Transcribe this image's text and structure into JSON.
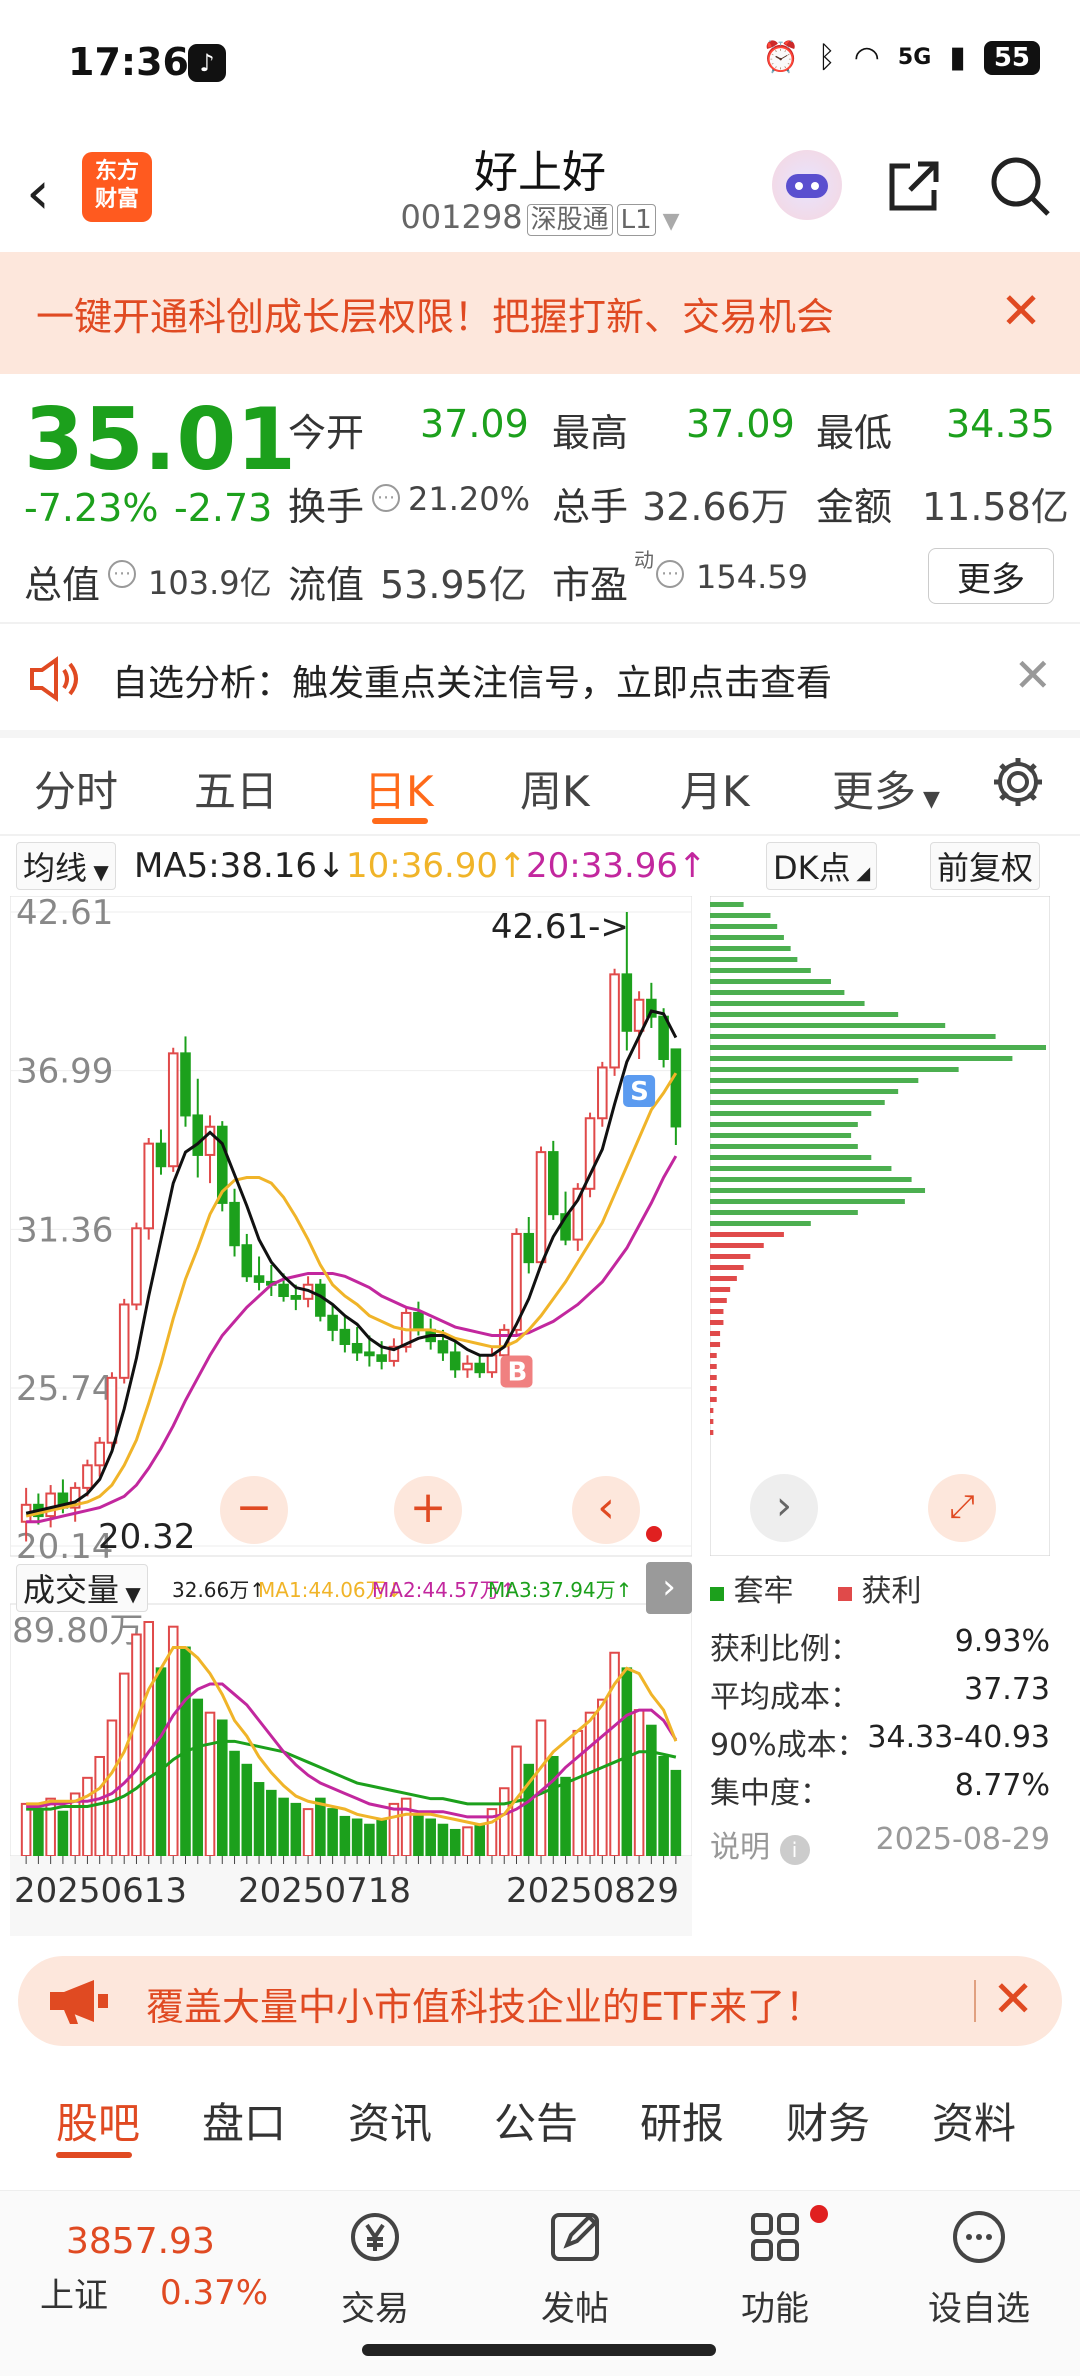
{
  "status_bar": {
    "time": "17:36",
    "signal": "5G",
    "battery": "55"
  },
  "header": {
    "logo_line1": "东方",
    "logo_line2": "财富",
    "title": "好上好",
    "code": "001298",
    "tag1": "深股通",
    "tag2": "L1"
  },
  "banner": {
    "text": "一键开通科创成长层权限！把握打新、交易机会"
  },
  "quote": {
    "price": "35.01",
    "change_pct": "-7.23%",
    "change": "-2.73",
    "open_label": "今开",
    "open": "37.09",
    "high_label": "最高",
    "high": "37.09",
    "low_label": "最低",
    "low": "34.35",
    "turnover_label": "换手",
    "turnover": "21.20%",
    "volume_label": "总手",
    "volume": "32.66万",
    "amount_label": "金额",
    "amount": "11.58亿",
    "mktcap_label": "总值",
    "mktcap": "103.9亿",
    "float_label": "流值",
    "float": "53.95亿",
    "pe_label": "市盈",
    "pe_sup": "动",
    "pe": "154.59",
    "more": "更多"
  },
  "notice": {
    "text": "自选分析：触发重点关注信号，立即点击查看"
  },
  "tabs": {
    "items": [
      "分时",
      "五日",
      "日K",
      "周K",
      "月K",
      "更多"
    ],
    "active": "日K"
  },
  "ma": {
    "selector": "均线",
    "ma5": "MA5:38.16",
    "ma10": "10:36.90",
    "ma20": "20:33.96",
    "dk": "DK点",
    "adj": "前复权"
  },
  "chart_data": {
    "type": "candlestick",
    "y_ticks": [
      "42.61",
      "36.99",
      "31.36",
      "25.74",
      "20.14"
    ],
    "ylim": [
      20.14,
      42.61
    ],
    "max_label": "42.61->",
    "min_label": "20.32",
    "candles": [
      [
        21.0,
        22.2,
        20.3,
        21.6
      ],
      [
        21.6,
        22.0,
        20.9,
        21.2
      ],
      [
        21.2,
        22.3,
        20.8,
        22.0
      ],
      [
        22.0,
        22.5,
        21.3,
        21.5
      ],
      [
        21.5,
        22.4,
        21.0,
        22.2
      ],
      [
        22.2,
        23.2,
        21.9,
        23.0
      ],
      [
        23.0,
        24.0,
        22.6,
        23.8
      ],
      [
        23.8,
        26.3,
        23.6,
        26.1
      ],
      [
        26.1,
        28.9,
        25.9,
        28.7
      ],
      [
        28.7,
        31.6,
        28.5,
        31.4
      ],
      [
        31.4,
        34.6,
        31.0,
        34.4
      ],
      [
        34.4,
        34.9,
        33.3,
        33.6
      ],
      [
        33.6,
        37.8,
        33.4,
        37.6
      ],
      [
        37.6,
        38.2,
        35.0,
        35.4
      ],
      [
        35.4,
        36.7,
        33.2,
        34.0
      ],
      [
        34.0,
        35.4,
        33.0,
        35.0
      ],
      [
        35.0,
        35.2,
        32.0,
        32.3
      ],
      [
        32.3,
        32.8,
        30.4,
        30.8
      ],
      [
        30.8,
        31.2,
        29.5,
        29.7
      ],
      [
        29.7,
        30.4,
        29.2,
        29.5
      ],
      [
        29.5,
        30.1,
        29.0,
        29.4
      ],
      [
        29.4,
        29.8,
        28.8,
        29.0
      ],
      [
        29.0,
        29.4,
        28.5,
        28.9
      ],
      [
        28.9,
        29.7,
        28.6,
        29.4
      ],
      [
        29.4,
        29.6,
        28.1,
        28.3
      ],
      [
        28.3,
        28.7,
        27.4,
        27.8
      ],
      [
        27.8,
        28.3,
        27.0,
        27.3
      ],
      [
        27.3,
        27.9,
        26.7,
        27.0
      ],
      [
        27.0,
        27.6,
        26.5,
        26.9
      ],
      [
        26.9,
        27.4,
        26.4,
        26.7
      ],
      [
        26.7,
        27.5,
        26.5,
        27.2
      ],
      [
        27.2,
        28.6,
        27.0,
        28.4
      ],
      [
        28.4,
        28.8,
        27.6,
        27.8
      ],
      [
        27.8,
        28.2,
        27.1,
        27.4
      ],
      [
        27.4,
        27.8,
        26.7,
        27.0
      ],
      [
        27.0,
        27.4,
        26.1,
        26.4
      ],
      [
        26.4,
        26.9,
        26.1,
        26.6
      ],
      [
        26.6,
        26.9,
        26.1,
        26.3
      ],
      [
        26.3,
        27.2,
        26.1,
        26.9
      ],
      [
        26.9,
        28.0,
        26.6,
        27.8
      ],
      [
        27.8,
        31.4,
        27.6,
        31.2
      ],
      [
        31.2,
        31.8,
        29.8,
        30.2
      ],
      [
        30.2,
        34.3,
        30.0,
        34.1
      ],
      [
        34.1,
        34.5,
        31.7,
        31.9
      ],
      [
        31.9,
        32.7,
        30.8,
        31.0
      ],
      [
        31.0,
        33.0,
        30.6,
        32.8
      ],
      [
        32.8,
        35.5,
        32.5,
        35.3
      ],
      [
        35.3,
        37.3,
        35.0,
        37.1
      ],
      [
        37.1,
        40.6,
        36.8,
        40.4
      ],
      [
        40.4,
        42.61,
        37.7,
        38.4
      ],
      [
        38.4,
        39.8,
        37.4,
        39.5
      ],
      [
        39.5,
        40.1,
        38.5,
        38.9
      ],
      [
        38.9,
        39.2,
        37.1,
        37.4
      ],
      [
        37.74,
        37.09,
        34.35,
        35.01
      ]
    ],
    "ma5": [
      21.3,
      21.4,
      21.5,
      21.6,
      21.7,
      22.0,
      22.5,
      23.5,
      25.0,
      26.8,
      29.0,
      31.0,
      33.0,
      34.1,
      34.4,
      34.8,
      34.4,
      33.3,
      32.2,
      31.0,
      30.2,
      29.7,
      29.3,
      29.2,
      29.0,
      28.7,
      28.3,
      28.0,
      27.5,
      27.2,
      27.1,
      27.3,
      27.5,
      27.6,
      27.6,
      27.4,
      27.1,
      26.9,
      26.9,
      27.2,
      28.0,
      28.9,
      30.1,
      31.1,
      31.8,
      32.4,
      33.3,
      34.2,
      35.8,
      37.3,
      38.2,
      39.1,
      39.0,
      38.16
    ],
    "ma10": [
      21.2,
      21.3,
      21.4,
      21.5,
      21.6,
      21.7,
      21.9,
      22.3,
      23.0,
      23.9,
      25.2,
      26.6,
      28.2,
      29.6,
      30.7,
      31.9,
      32.7,
      33.1,
      33.2,
      33.2,
      33.0,
      32.5,
      31.8,
      31.0,
      30.1,
      29.4,
      29.0,
      28.7,
      28.3,
      28.1,
      27.9,
      27.8,
      27.8,
      27.8,
      27.7,
      27.5,
      27.4,
      27.3,
      27.2,
      27.2,
      27.4,
      27.8,
      28.3,
      28.9,
      29.5,
      30.2,
      30.9,
      31.6,
      32.6,
      33.6,
      34.6,
      35.6,
      36.2,
      36.9
    ],
    "ma20": [
      21.0,
      21.0,
      21.1,
      21.2,
      21.3,
      21.4,
      21.5,
      21.7,
      21.9,
      22.3,
      22.9,
      23.6,
      24.4,
      25.3,
      26.1,
      26.9,
      27.6,
      28.1,
      28.6,
      29.0,
      29.4,
      29.6,
      29.7,
      29.8,
      29.8,
      29.8,
      29.7,
      29.5,
      29.3,
      29.0,
      28.8,
      28.6,
      28.5,
      28.3,
      28.1,
      27.9,
      27.8,
      27.7,
      27.6,
      27.6,
      27.6,
      27.7,
      27.9,
      28.1,
      28.4,
      28.7,
      29.1,
      29.5,
      30.1,
      30.7,
      31.5,
      32.3,
      33.2,
      33.96
    ],
    "b_mark": "B",
    "s_mark": "S",
    "volume": {
      "selector": "成交量",
      "legend": {
        "vol": "32.66万↑",
        "ma1": "MA1:44.06万↓",
        "ma2": "MA2:44.57万↑",
        "ma3": "MA3:37.94万↑"
      },
      "max_label": "89.80万",
      "values": [
        20,
        18,
        22,
        17,
        24,
        30,
        38,
        52,
        70,
        85,
        89.8,
        72,
        88,
        80,
        60,
        55,
        52,
        40,
        35,
        28,
        25,
        22,
        20,
        18,
        22,
        18,
        15,
        14,
        12,
        14,
        20,
        22,
        16,
        14,
        12,
        10,
        11,
        12,
        18,
        26,
        42,
        35,
        52,
        38,
        30,
        48,
        55,
        60,
        78,
        72,
        56,
        50,
        38,
        32.66
      ],
      "ma1": [
        20,
        20,
        21,
        21,
        21,
        23,
        26,
        32,
        40,
        52,
        64,
        72,
        80,
        80,
        76,
        70,
        62,
        52,
        46,
        38,
        32,
        27,
        23,
        21,
        20,
        19,
        18,
        16,
        15,
        14,
        15,
        16,
        16,
        16,
        15,
        14,
        13,
        12,
        13,
        16,
        22,
        28,
        34,
        40,
        44,
        48,
        52,
        58,
        66,
        72,
        70,
        62,
        56,
        44.06
      ],
      "ma2": [
        19,
        19,
        20,
        20,
        21,
        21,
        22,
        24,
        28,
        33,
        40,
        46,
        54,
        60,
        64,
        66,
        66,
        62,
        58,
        52,
        46,
        40,
        35,
        31,
        28,
        26,
        24,
        22,
        20,
        19,
        18,
        18,
        17,
        17,
        17,
        16,
        15,
        15,
        15,
        16,
        18,
        21,
        25,
        29,
        34,
        38,
        42,
        46,
        50,
        54,
        56,
        56,
        52,
        44.57
      ],
      "ma3": [
        18,
        18,
        18,
        19,
        19,
        19,
        20,
        21,
        23,
        26,
        30,
        33,
        37,
        40,
        42,
        43,
        44,
        44,
        43,
        42,
        41,
        40,
        38,
        36,
        34,
        32,
        30,
        28,
        27,
        26,
        25,
        24,
        23,
        22,
        22,
        21,
        20,
        20,
        20,
        20,
        21,
        22,
        24,
        26,
        28,
        30,
        32,
        34,
        36,
        38,
        40,
        40,
        39,
        37.94
      ],
      "dates": [
        "20250613",
        "20250718",
        "20250829"
      ]
    }
  },
  "distribution": {
    "legend_loss": "套牢",
    "legend_profit": "获利",
    "rows": [
      {
        "label": "获利比例：",
        "value": "9.93%"
      },
      {
        "label": "平均成本：",
        "value": "37.73"
      },
      {
        "label": "90%成本：",
        "value": "34.33-40.93"
      },
      {
        "label": "集中度：",
        "value": "8.77%"
      }
    ],
    "note_label": "说明",
    "date": "2025-08-29"
  },
  "etf": {
    "text": "覆盖大量中小市值科技企业的ETF来了！"
  },
  "bottom_tabs": {
    "items": [
      "股吧",
      "盘口",
      "资讯",
      "公告",
      "研报",
      "财务",
      "资料"
    ],
    "active": "股吧"
  },
  "bottom_nav": {
    "index_value": "3857.93",
    "index_name": "上证",
    "index_pct": "0.37%",
    "items": [
      "交易",
      "发帖",
      "功能",
      "设自选"
    ]
  },
  "colors": {
    "up": "#e04a4a",
    "down": "#1ca01c",
    "ma5": "#111111",
    "ma10": "#f0b429",
    "ma20": "#c2279e",
    "accent": "#ff6a1a"
  }
}
